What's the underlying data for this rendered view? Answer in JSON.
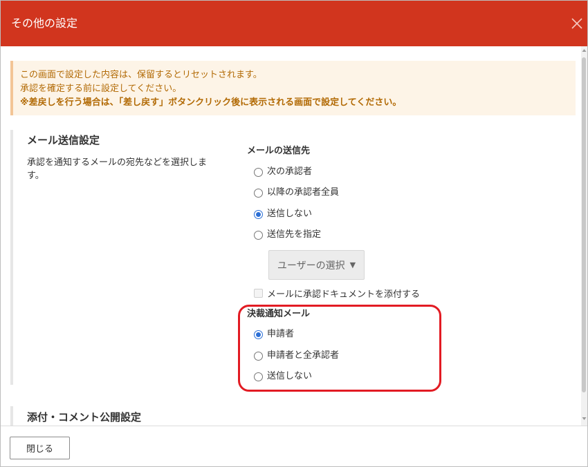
{
  "dialog": {
    "title": "その他の設定",
    "close_icon": "close-icon",
    "colors": {
      "header": "#d1351e",
      "notice_bg": "#fdf4e7",
      "notice_text": "#b26a05",
      "radio_accent": "#2b6fd6",
      "highlight": "#e21b23"
    }
  },
  "notice": {
    "line1": "この画面で設定した内容は、保留するとリセットされます。",
    "line2": "承認を確定する前に設定してください。",
    "line3": "※差戻しを行う場合は、「差し戻す」ボタンクリック後に表示される画面で設定してください。"
  },
  "mail_settings": {
    "title": "メール送信設定",
    "description": "承認を通知するメールの宛先などを選択します。",
    "recipient_group": {
      "label": "メールの送信先",
      "options": [
        {
          "label": "次の承認者",
          "selected": false
        },
        {
          "label": "以降の承認者全員",
          "selected": false
        },
        {
          "label": "送信しない",
          "selected": true
        },
        {
          "label": "送信先を指定",
          "selected": false
        }
      ]
    },
    "user_select": {
      "label": "ユーザーの選択",
      "caret": "▼"
    },
    "attach_checkbox": {
      "label": "メールに承認ドキュメントを添付する",
      "checked": false
    },
    "decision_group": {
      "label": "決裁通知メール",
      "options": [
        {
          "label": "申請者",
          "selected": true
        },
        {
          "label": "申請者と全承認者",
          "selected": false
        },
        {
          "label": "送信しない",
          "selected": false
        }
      ]
    }
  },
  "comment_settings": {
    "title": "添付・コメント公開設定"
  },
  "footer": {
    "close_label": "閉じる"
  }
}
